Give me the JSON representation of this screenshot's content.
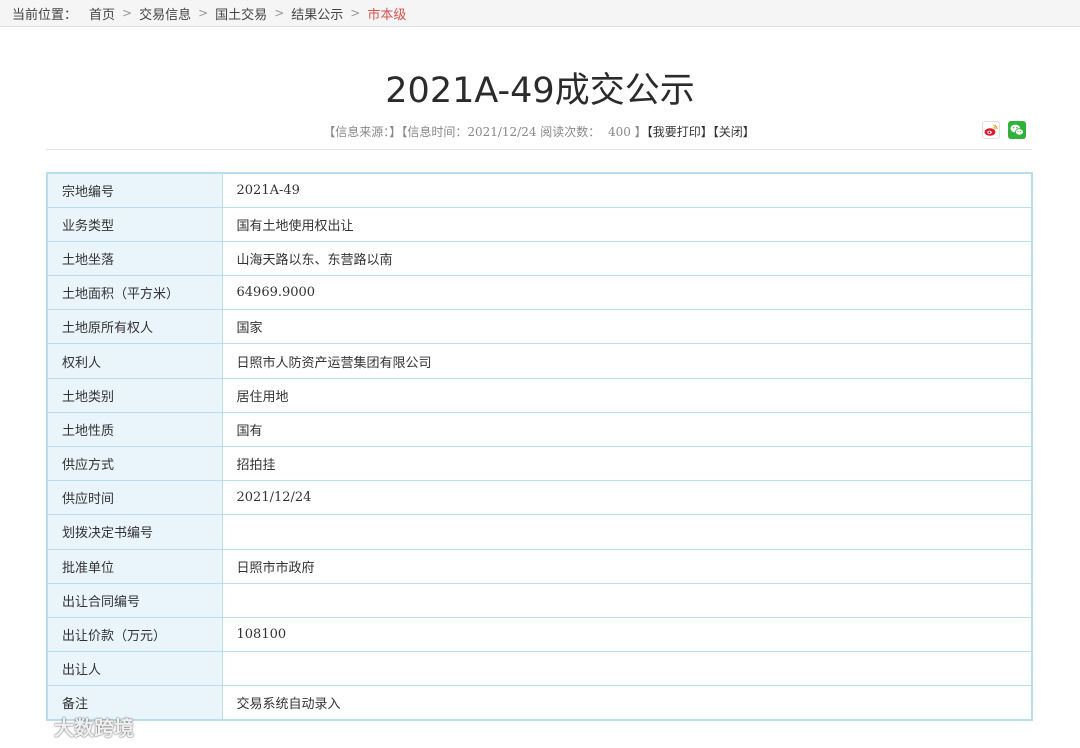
{
  "breadcrumb": {
    "label": "当前位置：",
    "items": [
      "首页",
      "交易信息",
      "国土交易",
      "结果公示"
    ],
    "current": "市本级"
  },
  "title": "2021A-49成交公示",
  "meta": {
    "source_prefix": "【信息来源：",
    "source_suffix": "】",
    "time_prefix": "【信息时间：2021/12/24 阅读次数：",
    "read_count": "400",
    "time_suffix": "】",
    "print": "【我要打印】",
    "close": "【关闭】"
  },
  "share": {
    "weibo_icon": "weibo-icon",
    "wechat_icon": "wechat-icon",
    "weibo_color": "#e6162d",
    "wechat_color": "#2fb13a"
  },
  "table": {
    "rows": [
      {
        "label": "宗地编号",
        "value": "2021A-49"
      },
      {
        "label": "业务类型",
        "value": "国有土地使用权出让"
      },
      {
        "label": "土地坐落",
        "value": "山海天路以东、东营路以南"
      },
      {
        "label": "土地面积（平方米）",
        "value": "64969.9000"
      },
      {
        "label": "土地原所有权人",
        "value": "国家"
      },
      {
        "label": "权利人",
        "value": "日照市人防资产运营集团有限公司"
      },
      {
        "label": "土地类别",
        "value": "居住用地"
      },
      {
        "label": "土地性质",
        "value": "国有"
      },
      {
        "label": "供应方式",
        "value": "招拍挂"
      },
      {
        "label": "供应时间",
        "value": "2021/12/24"
      },
      {
        "label": "划拨决定书编号",
        "value": ""
      },
      {
        "label": "批准单位",
        "value": "日照市市政府"
      },
      {
        "label": "出让合同编号",
        "value": ""
      },
      {
        "label": "出让价款（万元）",
        "value": "108100"
      },
      {
        "label": "出让人",
        "value": ""
      },
      {
        "label": "备注",
        "value": "交易系统自动录入"
      }
    ]
  },
  "watermark": {
    "text": "大数跨境"
  },
  "colors": {
    "accent_red": "#d9534f",
    "table_border": "#b9dcee",
    "label_bg": "#e9f4fb"
  }
}
